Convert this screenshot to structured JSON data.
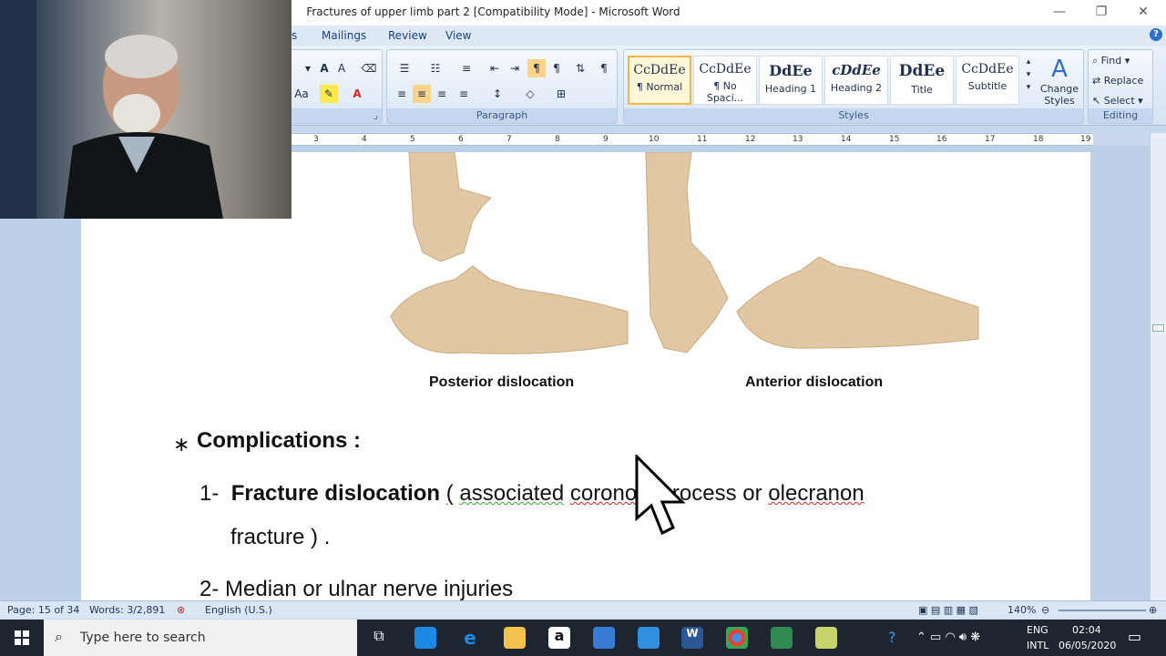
{
  "window": {
    "title": "Fractures of upper limb part 2 [Compatibility Mode] - Microsoft Word"
  },
  "tabs": [
    "Mailings",
    "Review",
    "View"
  ],
  "ribbon": {
    "paragraph_label": "Paragraph",
    "styles_label": "Styles",
    "editing_label": "Editing",
    "styles": [
      {
        "preview": "CcDdEe",
        "name": "¶ Normal"
      },
      {
        "preview": "CcDdEe",
        "name": "¶ No Spaci..."
      },
      {
        "preview": "DdEe",
        "name": "Heading 1"
      },
      {
        "preview": "cDdEe",
        "name": "Heading 2"
      },
      {
        "preview": "DdEe",
        "name": "Title"
      },
      {
        "preview": "CcDdEe",
        "name": "Subtitle"
      }
    ],
    "change_styles": "Change Styles",
    "find": "Find",
    "replace": "Replace",
    "select": "Select"
  },
  "ruler_ticks": [
    "3",
    "4",
    "5",
    "6",
    "7",
    "8",
    "9",
    "10",
    "11",
    "12",
    "13",
    "14",
    "15",
    "16",
    "17",
    "18",
    "19"
  ],
  "document": {
    "caption_left": "Posterior dislocation",
    "caption_right": "Anterior dislocation",
    "heading": "Complications :",
    "bullet": "∗",
    "item1_num": "1-",
    "item1_bold": "Fracture dislocation",
    "item1_open": "(",
    "item1_assoc": "associated",
    "item1_coronoid": "coronoid",
    "item1_mid": "process or",
    "item1_olecranon": "olecranon",
    "item1_line2": "fracture ) .",
    "item2": "2- Median or ulnar nerve injuries"
  },
  "status": {
    "page": "Page: 15 of 34",
    "words": "Words: 3/2,891",
    "lang": "English (U.S.)",
    "zoom": "140%"
  },
  "taskbar": {
    "search_placeholder": "Type here to search",
    "lang": "ENG",
    "layout": "INTL",
    "time": "02:04",
    "date": "06/05/2020"
  },
  "colors": {
    "ribbon": "#dfe9f5",
    "taskbar": "#1c2530",
    "bone": "#e2c8a2"
  }
}
